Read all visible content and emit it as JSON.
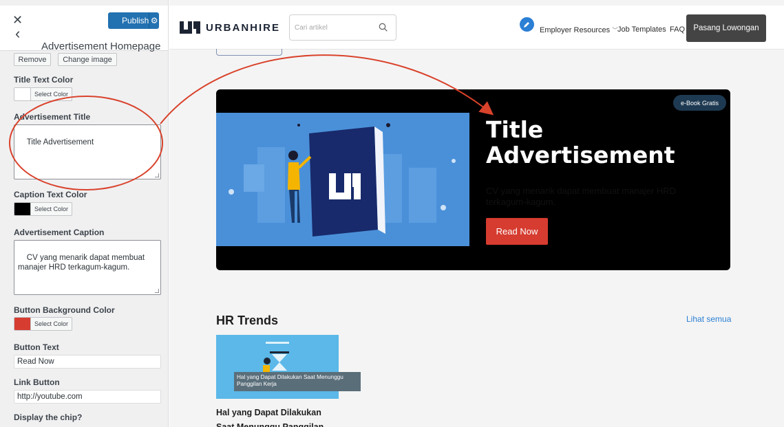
{
  "customizer": {
    "close_icon": "close-icon",
    "publish_label": "Publish",
    "back_icon": "back-arrow-icon",
    "section_title": "Advertisement Homepage",
    "remove_label": "Remove",
    "change_image_label": "Change image",
    "title_text_color_label": "Title Text Color",
    "title_text_color": "#ffffff",
    "select_color_label": "Select Color",
    "ad_title_label": "Advertisement Title",
    "ad_title_value": "Title Advertisement",
    "caption_color_label": "Caption Text Color",
    "caption_color": "#000000",
    "ad_caption_label": "Advertisement Caption",
    "ad_caption_value": "CV yang menarik dapat membuat manajer HRD terkagum-kagum.",
    "button_bg_label": "Button Background Color",
    "button_bg_color": "#d63c30",
    "button_text_label": "Button Text",
    "button_text_value": "Read Now",
    "link_button_label": "Link Button",
    "link_button_value": "http://youtube.com",
    "display_chip_label": "Display the chip?"
  },
  "site": {
    "logo_text": "URBANHIRE",
    "search_placeholder": "Cari artikel",
    "nav": {
      "employer_resources": "Employer Resources",
      "job_templates": "Job Templates",
      "faq": "FAQ"
    },
    "cta_label": "Pasang Lowongan",
    "hero": {
      "chip": "e-Book Gratis",
      "title": "Title Advertisement",
      "caption": "CV yang menarik dapat membuat manajer HRD terkagum-kagum.",
      "button": "Read Now"
    },
    "hr_trends": {
      "title": "HR Trends",
      "see_all": "Lihat semua",
      "card_tooltip": "Hal yang Dapat Dilakukan Saat Menunggu Panggilan Kerja",
      "card_title": "Hal yang Dapat Dilakukan Saat Menunggu Panggilan"
    }
  },
  "colors": {
    "publish_blue": "#2271b1",
    "hero_bg": "#000000",
    "read_button": "#d63c30",
    "annotation_red": "#d9422b",
    "link_blue": "#2b7fd4"
  }
}
